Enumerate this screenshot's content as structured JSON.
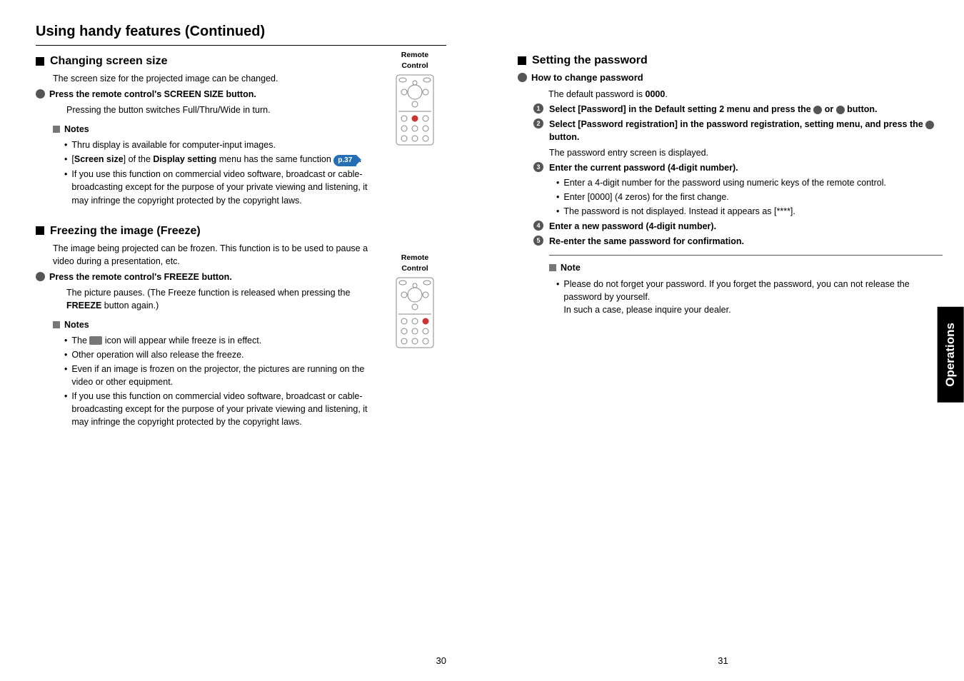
{
  "left": {
    "title": "Using handy features (Continued)",
    "sec1": {
      "heading": "Changing screen size",
      "intro": "The screen size for the projected image can be changed.",
      "press": "Press the remote control's SCREEN SIZE button.",
      "press_desc": "Pressing the button switches Full/Thru/Wide in turn.",
      "notes_h": "Notes",
      "n1": "Thru display is available for computer-input images.",
      "n2a": "[",
      "n2b": "Screen size",
      "n2c": "] of the ",
      "n2d": "Display setting",
      "n2e": " menu has the same function ",
      "n2ref": "p.37",
      "n2f": " .",
      "n3": "If you use this function on commercial video software, broadcast or cable-broadcasting except for the purpose of your private viewing and listening, it may infringe the copyright protected by the copyright laws.",
      "rc_label": "Remote Control"
    },
    "sec2": {
      "heading": "Freezing the image (Freeze)",
      "intro": "The image being projected can be frozen. This function is to be used to pause a video during a presentation, etc.",
      "press": "Press the remote control's FREEZE button.",
      "press_desc1": "The picture pauses. (The Freeze function is released when pressing the ",
      "press_desc_bold": "FREEZE",
      "press_desc2": " button again.)",
      "notes_h": "Notes",
      "n1a": "The ",
      "n1b": " icon will appear while freeze is in effect.",
      "n2": "Other operation will also release the freeze.",
      "n3": "Even if an image is frozen on the projector, the pictures are running on the video or other equipment.",
      "n4": "If you use this function on commercial video software, broadcast or cable-broadcasting except for the purpose of your private viewing and listening, it may infringe the copyright protected by the copyright laws.",
      "rc_label": "Remote Control"
    },
    "pagenum": "30"
  },
  "right": {
    "sec": {
      "heading": "Setting the password",
      "sub1": "How to change password",
      "sub1_desc_a": "The default password is ",
      "sub1_desc_b": "0000",
      "sub1_desc_c": ".",
      "s1a": "Select [Password] in the Default setting 2 menu and press the ",
      "s1b": " or ",
      "s1c": " button.",
      "s2a": "Select [Password registration] in the password registration, setting menu, and press the ",
      "s2b": " button.",
      "s2_desc": "The password entry screen is displayed.",
      "s3": "Enter the current password (4-digit number).",
      "s3_b1": "Enter a 4-digit number for the password using numeric keys of the remote control.",
      "s3_b2": "Enter [0000] (4 zeros) for the first change.",
      "s3_b3": "The password is not displayed. Instead it appears as [****].",
      "s4": "Enter a new password (4-digit number).",
      "s5": "Re-enter the same password for confirmation.",
      "note_h": "Note",
      "note_b1": "Please do not forget your password. If you forget the password, you can not release the password by yourself.",
      "note_b2": "In such a case, please inquire your dealer."
    },
    "sidetab": "Operations",
    "pagenum": "31"
  }
}
